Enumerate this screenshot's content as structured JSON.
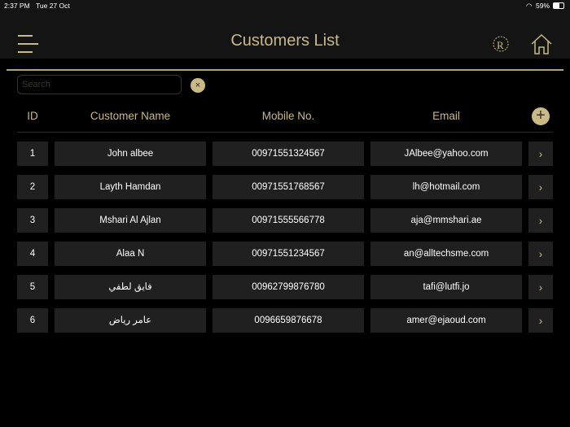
{
  "status": {
    "time": "2:37 PM",
    "date": "Tue 27 Oct",
    "battery": "59%"
  },
  "header": {
    "title": "Customers List"
  },
  "search": {
    "placeholder": "Search",
    "clear": "×"
  },
  "columns": {
    "id": "ID",
    "name": "Customer Name",
    "mobile": "Mobile No.",
    "email": "Email"
  },
  "add_label": "+",
  "chevron": "›",
  "rows": [
    {
      "id": "1",
      "name": "John albee",
      "mobile": "00971551324567",
      "email": "JAlbee@yahoo.com"
    },
    {
      "id": "2",
      "name": "Layth Hamdan",
      "mobile": "00971551768567",
      "email": "lh@hotmail.com"
    },
    {
      "id": "3",
      "name": "Mshari Al Ajlan",
      "mobile": "00971555566778",
      "email": "aja@mmshari.ae"
    },
    {
      "id": "4",
      "name": "Alaa N",
      "mobile": "00971551234567",
      "email": "an@alltechsme.com"
    },
    {
      "id": "5",
      "name": "فايق لطفي",
      "mobile": "00962799876780",
      "email": "tafi@lutfi.jo"
    },
    {
      "id": "6",
      "name": "عامر رياض",
      "mobile": "0096659876678",
      "email": "amer@ejaoud.com"
    }
  ],
  "colors": {
    "gold": "#c8b986",
    "cell": "#202020"
  }
}
